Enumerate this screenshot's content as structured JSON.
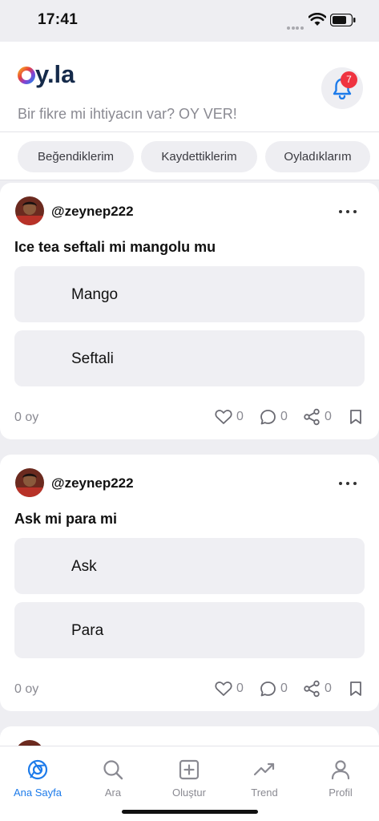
{
  "status_bar": {
    "time": "17:41",
    "battery_icon": "battery-icon",
    "wifi_icon": "wifi-icon"
  },
  "header": {
    "logo_text": "oy.la",
    "tagline": "Bir fikre mi ihtiyacın var? OY VER!",
    "notification_count": "7",
    "bell_icon": "bell-icon"
  },
  "filters": [
    {
      "label": "Beğendiklerim"
    },
    {
      "label": "Kaydettiklerim"
    },
    {
      "label": "Oyladıklarım"
    }
  ],
  "posts": [
    {
      "username": "@zeynep222",
      "question": "Ice tea seftali mi mangolu mu",
      "options": [
        {
          "label": "Mango"
        },
        {
          "label": "Seftali"
        }
      ],
      "votes": "0 oy",
      "likes": "0",
      "comments": "0",
      "shares": "0"
    },
    {
      "username": "@zeynep222",
      "question": "Ask mi para mi",
      "options": [
        {
          "label": "Ask"
        },
        {
          "label": "Para"
        }
      ],
      "votes": "0 oy",
      "likes": "0",
      "comments": "0",
      "shares": "0"
    }
  ],
  "bottom_nav": [
    {
      "label": "Ana Sayfa",
      "icon": "home-icon",
      "active": true
    },
    {
      "label": "Ara",
      "icon": "search-icon"
    },
    {
      "label": "Oluştur",
      "icon": "create-icon"
    },
    {
      "label": "Trend",
      "icon": "trend-icon"
    },
    {
      "label": "Profil",
      "icon": "profile-icon"
    }
  ],
  "colors": {
    "accent": "#1d7bea",
    "badge": "#ef3340",
    "background": "#eeeef2",
    "muted_text": "#8a8a92"
  }
}
